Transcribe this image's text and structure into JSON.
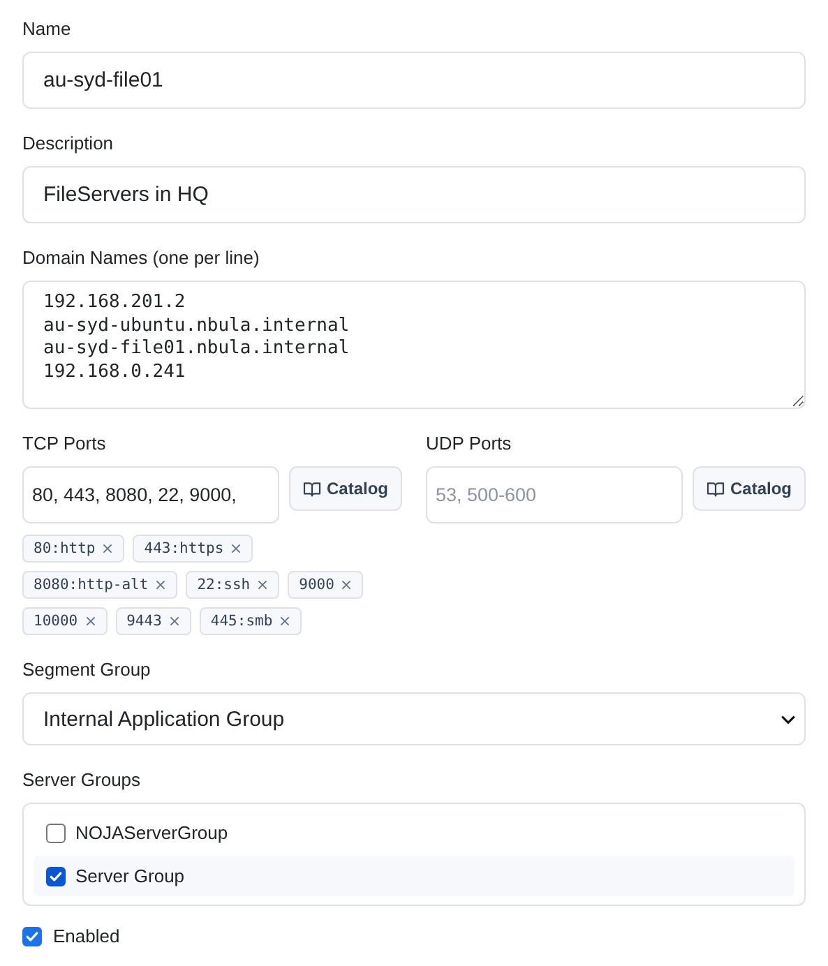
{
  "name": {
    "label": "Name",
    "value": "au-syd-file01"
  },
  "description": {
    "label": "Description",
    "value": "FileServers in HQ"
  },
  "domain_names": {
    "label": "Domain Names (one per line)",
    "value": "192.168.201.2\nau-syd-ubuntu.nbula.internal\nau-syd-file01.nbula.internal\n192.168.0.241"
  },
  "tcp_ports": {
    "label": "TCP Ports",
    "value": "80, 443, 8080, 22, 9000,",
    "button": "Catalog",
    "chips": [
      {
        "label": "80:http"
      },
      {
        "label": "443:https"
      },
      {
        "label": "8080:http-alt"
      },
      {
        "label": "22:ssh"
      },
      {
        "label": "9000"
      },
      {
        "label": "10000"
      },
      {
        "label": "9443"
      },
      {
        "label": "445:smb"
      }
    ]
  },
  "udp_ports": {
    "label": "UDP Ports",
    "placeholder": "53, 500-600",
    "button": "Catalog"
  },
  "segment_group": {
    "label": "Segment Group",
    "value": "Internal Application Group"
  },
  "server_groups": {
    "label": "Server Groups",
    "items": [
      {
        "label": "NOJAServerGroup",
        "checked": false
      },
      {
        "label": "Server Group",
        "checked": true
      }
    ]
  },
  "enabled": {
    "label": "Enabled",
    "checked": true
  }
}
